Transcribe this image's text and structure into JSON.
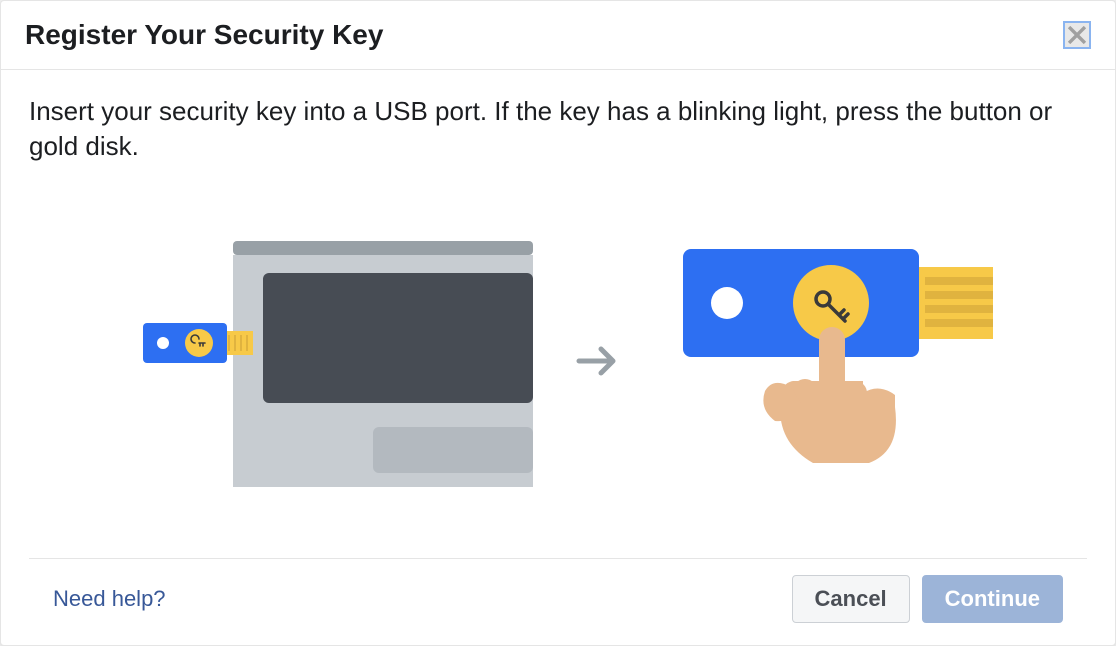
{
  "dialog": {
    "title": "Register Your Security Key",
    "instruction": "Insert your security key into a USB port. If the key has a blinking light, press the button or gold disk.",
    "help_link": "Need help?",
    "cancel_label": "Cancel",
    "continue_label": "Continue"
  }
}
